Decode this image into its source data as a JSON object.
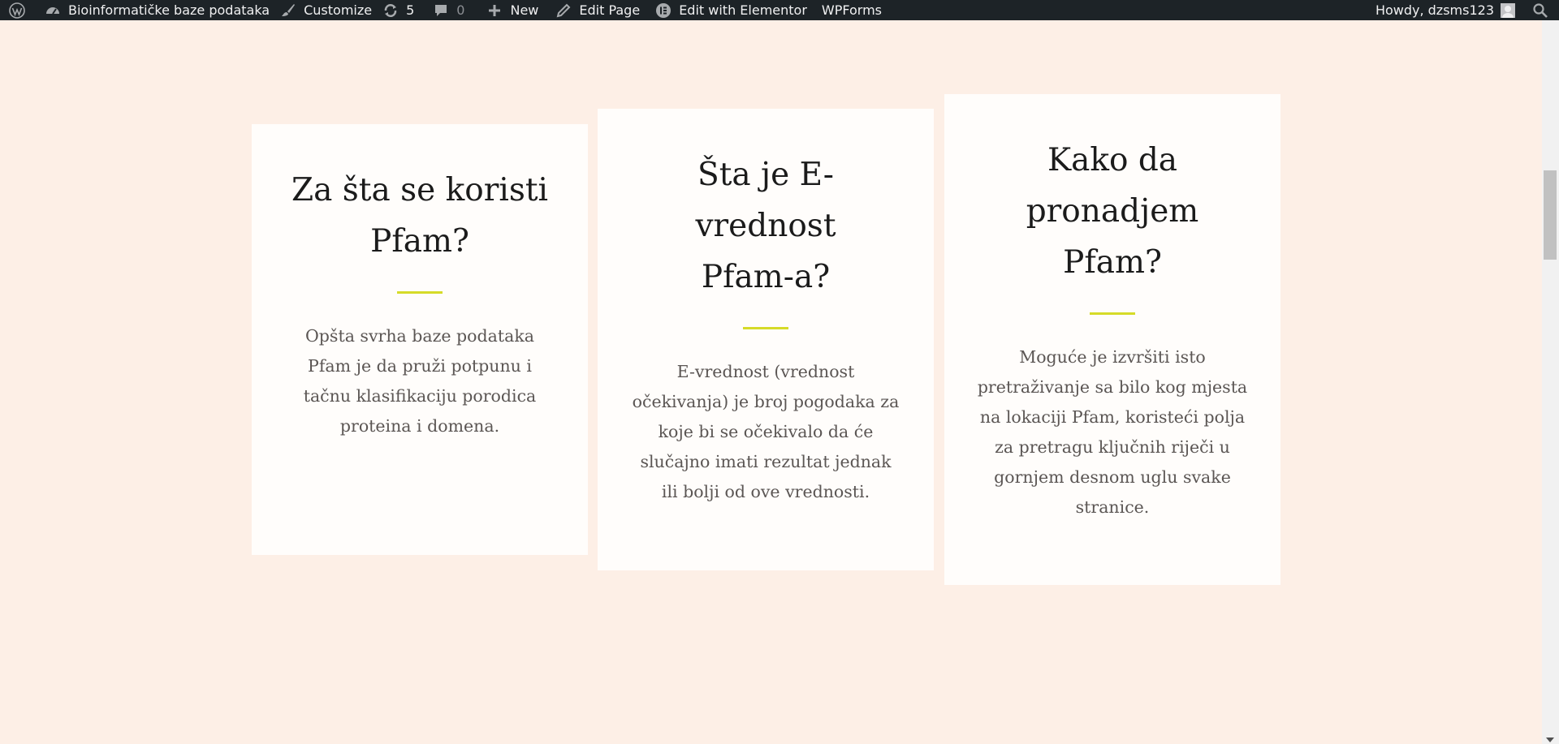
{
  "adminbar": {
    "wp_logo_icon": "wordpress-icon",
    "site_name": "Bioinformatičke baze podataka",
    "customize": "Customize",
    "updates_count": "5",
    "comments_count": "0",
    "new": "New",
    "edit_page": "Edit Page",
    "edit_elementor": "Edit with Elementor",
    "wpforms": "WPForms",
    "howdy": "Howdy, dzsms123"
  },
  "cards": [
    {
      "title_line1": "Za šta se koristi",
      "title_line2": "Pfam?",
      "body": "Opšta svrha baze podataka Pfam je da pruži potpunu i tačnu klasifikaciju porodica proteina i domena."
    },
    {
      "title_line1": "Šta je E-vrednost",
      "title_line2": "Pfam-a?",
      "body": "E-vrednost (vrednost očekivanja) je broj pogodaka za koje bi se očekivalo da će slučajno imati rezultat jednak ili bolji od ove vrednosti."
    },
    {
      "title_line1": "Kako da",
      "title_line2": "pronadjem Pfam?",
      "body": "Moguće je izvršiti isto pretraživanje sa bilo kog mjesta na lokaciji Pfam, koristeći polja za pretragu ključnih riječi u gornjem desnom uglu svake stranice."
    }
  ],
  "colors": {
    "adminbar_bg": "#1d2327",
    "page_bg": "#fdefe6",
    "card_bg": "#fffdfb",
    "divider": "#d6db28",
    "heading": "#1b1b1b",
    "body_text": "#5b5654"
  }
}
